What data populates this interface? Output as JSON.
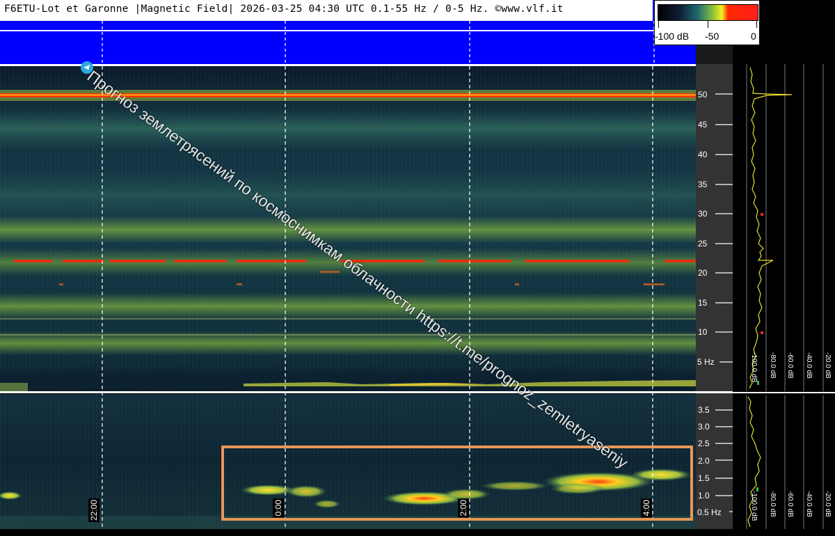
{
  "header": {
    "title": "F6ETU-Lot et Garonne |Magnetic Field| 2026-03-25 04:30 UTC 0.1-55 Hz / 0-5 Hz. ©www.vlf.it"
  },
  "colorbar": {
    "labels": [
      "-100 dB",
      "-50",
      "0"
    ]
  },
  "upper_panel": {
    "y_ticks": [
      "50",
      "45",
      "40",
      "35",
      "30",
      "25",
      "20",
      "15",
      "10",
      "5 Hz"
    ]
  },
  "lower_panel": {
    "y_ticks": [
      "3.5",
      "3.0",
      "2.5",
      "2.0",
      "1.5",
      "1.0",
      "0.5 Hz"
    ]
  },
  "time_axis": {
    "labels": [
      "22:00",
      "0:00",
      "2:00",
      "4:00"
    ]
  },
  "profile_labels": {
    "upper": [
      "-100.0 dB",
      "-80.0 dB",
      "-60.0 dB",
      "-40.0 dB",
      "-20.0 dB"
    ],
    "lower": [
      "-100.0 dB",
      "-80.0 dB",
      "-60.0 dB",
      "-40.0 dB",
      "-20.0 dB"
    ]
  },
  "watermark": {
    "text": "Прогноз землетрясений по космоснимкам облачности  https://t.me/prognoz_zemletryaseniy"
  },
  "colors": {
    "header_blue": "#0000ff",
    "highlight": "#e79655",
    "line50": "#ff3300"
  }
}
